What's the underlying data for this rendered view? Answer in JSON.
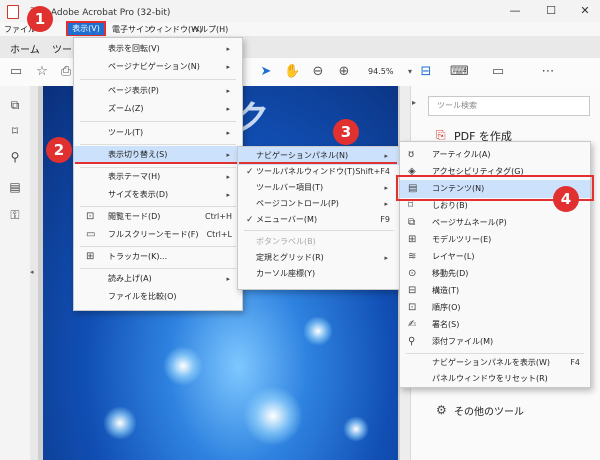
{
  "window": {
    "title": "票… Adobe Acrobat Pro (32-bit)",
    "minimize": "—",
    "maximize": "☐",
    "close": "✕"
  },
  "menubar": {
    "items": [
      "ファイル",
      "表示(V)",
      "電子サイン",
      "ウィンドウ(W)",
      "ヘルプ(H)"
    ],
    "active": "表示(V)"
  },
  "tabs": {
    "home": "ホーム",
    "tools": "ツール"
  },
  "toolbar": {
    "zoom": "94.5%"
  },
  "document": {
    "title_text": "ク"
  },
  "right_panel": {
    "search_placeholder": "ツール検索",
    "pdf_create": "PDF を作成",
    "other_tools": "その他のツール"
  },
  "view_menu": {
    "items": [
      {
        "label": "表示を回転(V)",
        "arrow": "▸"
      },
      {
        "label": "ページナビゲーション(N)",
        "arrow": "▸"
      },
      {
        "label": "ページ表示(P)",
        "arrow": "▸"
      },
      {
        "label": "ズーム(Z)",
        "arrow": "▸"
      },
      {
        "label": "ツール(T)",
        "arrow": "▸"
      },
      {
        "label": "表示切り替え(S)",
        "arrow": "▸"
      },
      {
        "label": "表示テーマ(H)",
        "arrow": "▸"
      },
      {
        "label": "サイズを表示(D)",
        "arrow": "▸"
      },
      {
        "label": "閲覧モード(D)",
        "shortcut": "Ctrl+H"
      },
      {
        "label": "フルスクリーンモード(F)",
        "shortcut": "Ctrl+L"
      },
      {
        "label": "トラッカー(K)..."
      },
      {
        "label": "読み上げ(A)",
        "arrow": "▸"
      },
      {
        "label": "ファイルを比較(O)"
      }
    ]
  },
  "toggle_menu": {
    "items": [
      {
        "label": "ナビゲーションパネル(N)",
        "arrow": "▸"
      },
      {
        "label": "ツールパネルウィンドウ(T)",
        "shortcut": "Shift+F4",
        "checked": true
      },
      {
        "label": "ツールバー項目(T)",
        "arrow": "▸"
      },
      {
        "label": "ページコントロール(P)",
        "arrow": "▸"
      },
      {
        "label": "メニューバー(M)",
        "shortcut": "F9",
        "checked": true
      },
      {
        "label": "ボタンラベル(B)",
        "disabled": true
      },
      {
        "label": "定規とグリッド(R)",
        "arrow": "▸"
      },
      {
        "label": "カーソル座標(Y)"
      }
    ]
  },
  "nav_menu": {
    "items": [
      {
        "label": "アーティクル(A)",
        "icon": "article-icon",
        "glyph": "ʊ"
      },
      {
        "label": "アクセシビリティタグ(G)",
        "icon": "tag-icon",
        "glyph": "◈"
      },
      {
        "label": "コンテンツ(N)",
        "icon": "contents-icon",
        "glyph": "▤"
      },
      {
        "label": "しおり(B)",
        "icon": "bookmark-icon",
        "glyph": "⌑"
      },
      {
        "label": "ページサムネール(P)",
        "icon": "thumbnails-icon",
        "glyph": "⧉"
      },
      {
        "label": "モデルツリー(E)",
        "icon": "model-tree-icon",
        "glyph": "⊞"
      },
      {
        "label": "レイヤー(L)",
        "icon": "layers-icon",
        "glyph": "≋"
      },
      {
        "label": "移動先(D)",
        "icon": "destination-icon",
        "glyph": "⊙"
      },
      {
        "label": "構造(T)",
        "icon": "structure-icon",
        "glyph": "⊟"
      },
      {
        "label": "順序(O)",
        "icon": "order-icon",
        "glyph": "⊡"
      },
      {
        "label": "署名(S)",
        "icon": "signature-icon",
        "glyph": "✍"
      },
      {
        "label": "添付ファイル(M)",
        "icon": "attachment-icon",
        "glyph": "⚲"
      },
      {
        "label": "ナビゲーションパネルを表示(W)",
        "shortcut": "F4"
      },
      {
        "label": "パネルウィンドウをリセット(R)"
      }
    ]
  },
  "callouts": [
    "1",
    "2",
    "3",
    "4"
  ]
}
